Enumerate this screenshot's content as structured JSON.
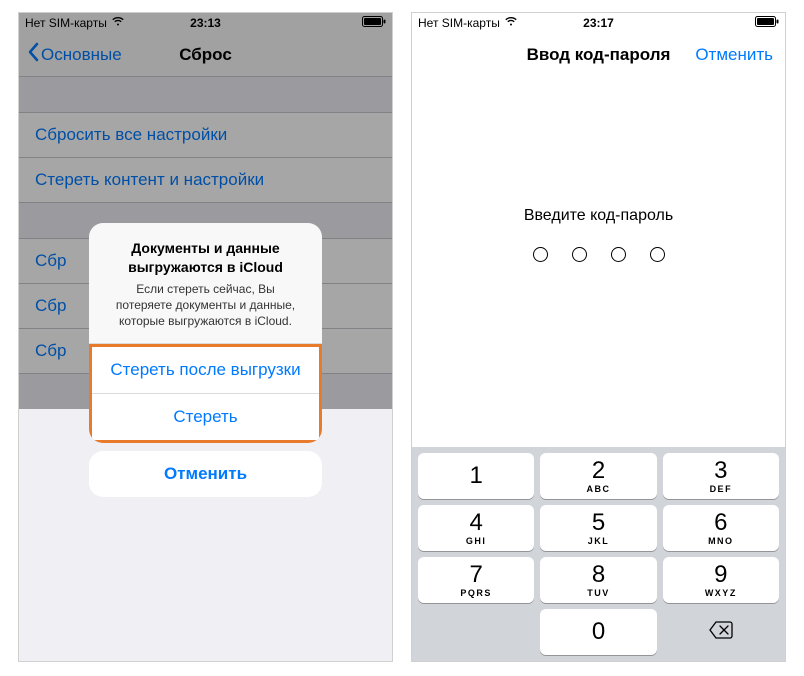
{
  "screen1": {
    "status": {
      "carrier": "Нет SIM-карты",
      "time": "23:13"
    },
    "nav": {
      "back": "Основные",
      "title": "Сброс"
    },
    "list": {
      "group1": [
        "Сбросить все настройки",
        "Стереть контент и настройки"
      ],
      "group2": [
        "Сбр",
        "Сбр",
        "Сбр"
      ]
    },
    "alert": {
      "title": "Документы и данные выгружаются в iCloud",
      "message": "Если стереть сейчас, Вы потеряете документы и данные, которые выгружаются в iCloud.",
      "btn_after_upload": "Стереть после выгрузки",
      "btn_erase": "Стереть",
      "btn_cancel": "Отменить"
    }
  },
  "screen2": {
    "status": {
      "carrier": "Нет SIM-карты",
      "time": "23:17"
    },
    "nav": {
      "title": "Ввод код-пароля",
      "cancel": "Отменить"
    },
    "prompt": "Введите код-пароль",
    "keys": [
      {
        "d": "1",
        "l": ""
      },
      {
        "d": "2",
        "l": "ABC"
      },
      {
        "d": "3",
        "l": "DEF"
      },
      {
        "d": "4",
        "l": "GHI"
      },
      {
        "d": "5",
        "l": "JKL"
      },
      {
        "d": "6",
        "l": "MNO"
      },
      {
        "d": "7",
        "l": "PQRS"
      },
      {
        "d": "8",
        "l": "TUV"
      },
      {
        "d": "9",
        "l": "WXYZ"
      },
      {
        "d": "",
        "l": ""
      },
      {
        "d": "0",
        "l": ""
      },
      {
        "d": "⌫",
        "l": ""
      }
    ]
  }
}
